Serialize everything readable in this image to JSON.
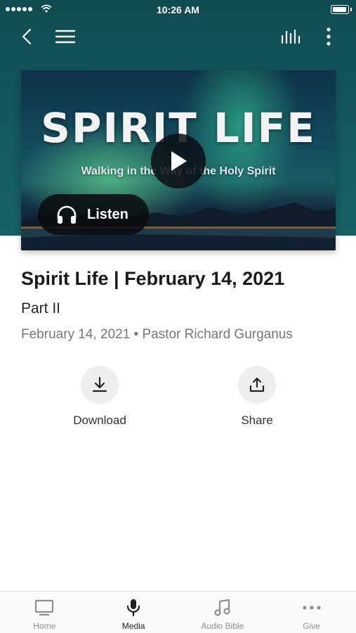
{
  "status_bar": {
    "time": "10:26 AM"
  },
  "hero": {
    "title_art": "SPIRIT LIFE",
    "subtitle_art": "Walking in the Way of the Holy Spirit",
    "listen_label": "Listen"
  },
  "sermon": {
    "title": "Spirit Life | February 14, 2021",
    "part": "Part II",
    "meta": "February 14, 2021 • Pastor Richard Gurganus"
  },
  "actions": {
    "download_label": "Download",
    "share_label": "Share"
  },
  "tabs": [
    {
      "label": "Home",
      "icon": "tv-icon"
    },
    {
      "label": "Media",
      "icon": "microphone-icon",
      "active": true
    },
    {
      "label": "Audio Bible",
      "icon": "music-note-icon"
    },
    {
      "label": "Give",
      "icon": "more-dots-icon"
    }
  ],
  "colors": {
    "header": "#14595f",
    "tab_active": "#1f1f1f",
    "tab_inactive": "#8f8f8f"
  }
}
